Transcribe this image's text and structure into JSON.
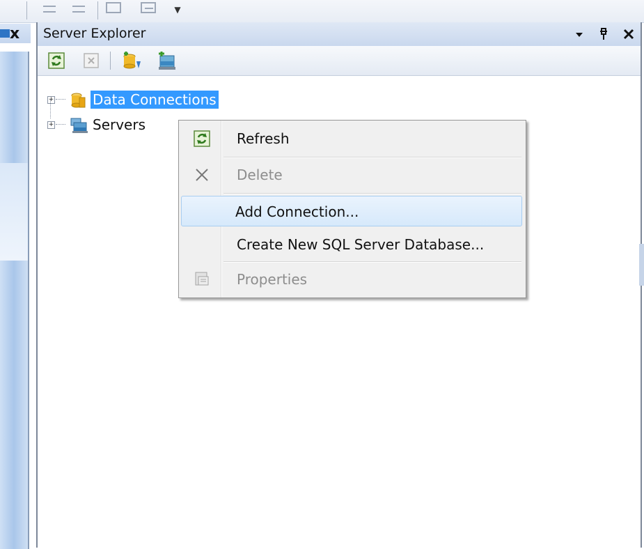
{
  "server_explorer": {
    "title": "Server Explorer",
    "title_controls": {
      "dropdown_icon": "chevron-down-icon",
      "pin_icon": "pin-icon",
      "close_icon": "close-icon"
    },
    "toolbar": [
      "refresh-icon",
      "delete-icon",
      "connect-to-database-icon",
      "connect-to-server-icon"
    ]
  },
  "left_pane": {
    "close_glyph": "x"
  },
  "top_toolbar": {
    "overflow_glyph": "▼"
  },
  "tree": {
    "expander_glyph": "+",
    "nodes": [
      {
        "label": "Data Connections",
        "icon": "database-icon",
        "selected": true
      },
      {
        "label": "Servers",
        "icon": "servers-icon",
        "selected": false
      }
    ]
  },
  "context_menu": {
    "items": [
      {
        "label": "Refresh",
        "icon": "refresh-icon",
        "enabled": true
      },
      {
        "label": "Delete",
        "icon": "delete-x-icon",
        "enabled": false
      },
      {
        "label": "Add Connection...",
        "icon": "",
        "enabled": true,
        "highlighted": true
      },
      {
        "label": "Create New SQL Server Database...",
        "icon": "",
        "enabled": true
      },
      {
        "label": "Properties",
        "icon": "properties-icon",
        "enabled": false
      }
    ]
  },
  "colors": {
    "selection": "#3399ff",
    "menu_bg": "#f0f0f0",
    "title_bar": "#c9d8ee",
    "disabled_text": "#8d8d8d"
  }
}
